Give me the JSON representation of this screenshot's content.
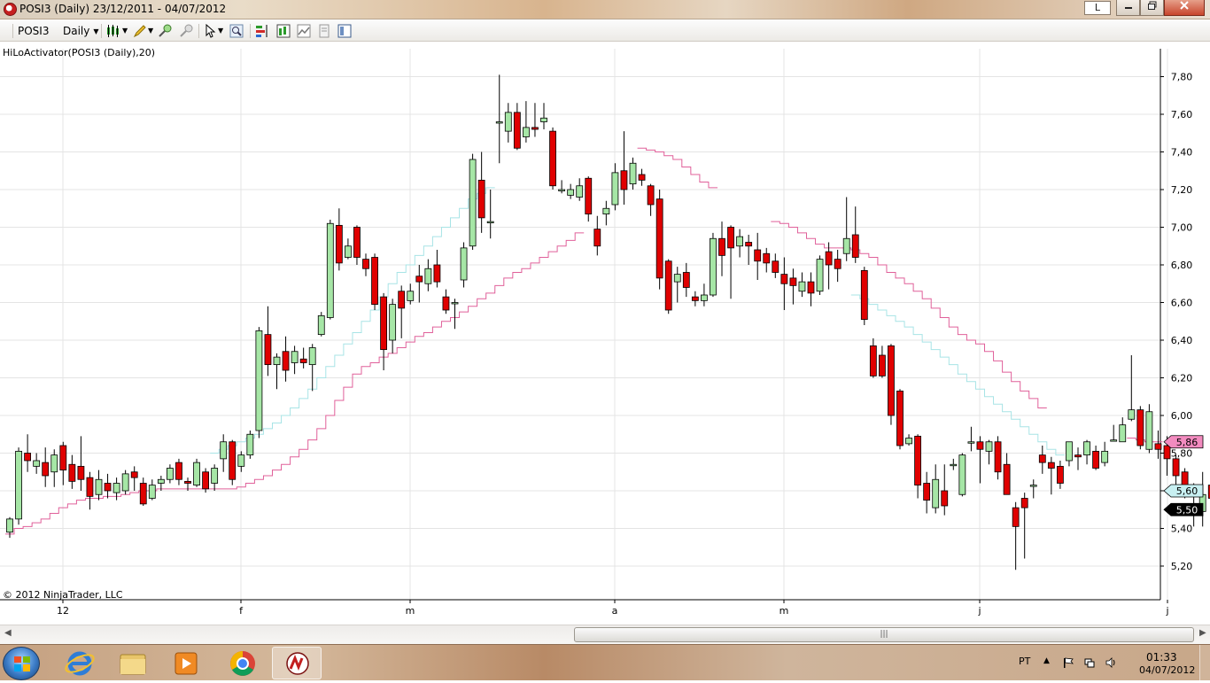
{
  "window": {
    "title": "POSI3 (Daily)  23/12/2011 - 04/07/2012",
    "btn_l": "L"
  },
  "toolbar": {
    "instrument": "POSI3",
    "interval": "Daily"
  },
  "chart": {
    "indicator_label": "HiLoActivator(POSI3 (Daily),20)",
    "copyright": "© 2012 NinjaTrader, LLC",
    "price_tag_upper": "5,86",
    "price_tag_mid": "5,60",
    "price_tag_last": "5,50"
  },
  "chart_data": {
    "type": "candlestick",
    "ylim": [
      5.1,
      7.9
    ],
    "y_ticks": [
      "7,80",
      "7,60",
      "7,40",
      "7,20",
      "7,00",
      "6,80",
      "6,60",
      "6,40",
      "6,20",
      "6,00",
      "5,80",
      "5,60",
      "5,40",
      "5,20"
    ],
    "x_tick_labels": [
      "12",
      "f",
      "m",
      "a",
      "m",
      "j",
      "j"
    ],
    "x_tick_index": [
      6,
      26,
      45,
      68,
      87,
      109,
      130
    ],
    "candles": [
      [
        5.38,
        5.45,
        5.35,
        5.46
      ],
      [
        5.45,
        5.81,
        5.42,
        5.83
      ],
      [
        5.8,
        5.76,
        5.7,
        5.9
      ],
      [
        5.73,
        5.76,
        5.69,
        5.8
      ],
      [
        5.75,
        5.68,
        5.62,
        5.83
      ],
      [
        5.7,
        5.79,
        5.62,
        5.82
      ],
      [
        5.84,
        5.71,
        5.63,
        5.86
      ],
      [
        5.74,
        5.65,
        5.61,
        5.79
      ],
      [
        5.73,
        5.66,
        5.6,
        5.89
      ],
      [
        5.67,
        5.57,
        5.5,
        5.7
      ],
      [
        5.58,
        5.66,
        5.55,
        5.71
      ],
      [
        5.64,
        5.6,
        5.56,
        5.69
      ],
      [
        5.59,
        5.64,
        5.55,
        5.67
      ],
      [
        5.6,
        5.69,
        5.58,
        5.71
      ],
      [
        5.7,
        5.67,
        5.6,
        5.73
      ],
      [
        5.64,
        5.53,
        5.52,
        5.67
      ],
      [
        5.56,
        5.63,
        5.55,
        5.66
      ],
      [
        5.64,
        5.66,
        5.6,
        5.68
      ],
      [
        5.66,
        5.72,
        5.64,
        5.74
      ],
      [
        5.75,
        5.66,
        5.63,
        5.77
      ],
      [
        5.65,
        5.64,
        5.6,
        5.67
      ],
      [
        5.63,
        5.75,
        5.62,
        5.77
      ],
      [
        5.7,
        5.61,
        5.59,
        5.72
      ],
      [
        5.64,
        5.72,
        5.6,
        5.74
      ],
      [
        5.77,
        5.86,
        5.7,
        5.9
      ],
      [
        5.86,
        5.66,
        5.63,
        5.87
      ],
      [
        5.73,
        5.79,
        5.7,
        5.81
      ],
      [
        5.79,
        5.9,
        5.77,
        5.92
      ],
      [
        5.92,
        6.45,
        5.88,
        6.47
      ],
      [
        6.43,
        6.27,
        6.21,
        6.58
      ],
      [
        6.27,
        6.31,
        6.14,
        6.33
      ],
      [
        6.34,
        6.24,
        6.18,
        6.42
      ],
      [
        6.28,
        6.34,
        6.22,
        6.37
      ],
      [
        6.3,
        6.28,
        6.25,
        6.36
      ],
      [
        6.27,
        6.36,
        6.13,
        6.38
      ],
      [
        6.43,
        6.53,
        6.42,
        6.55
      ],
      [
        6.52,
        7.02,
        6.51,
        7.04
      ],
      [
        7.01,
        6.81,
        6.77,
        7.1
      ],
      [
        6.84,
        6.9,
        6.83,
        6.94
      ],
      [
        7.0,
        6.84,
        6.8,
        7.01
      ],
      [
        6.83,
        6.78,
        6.74,
        6.86
      ],
      [
        6.84,
        6.59,
        6.56,
        6.86
      ],
      [
        6.63,
        6.35,
        6.24,
        6.65
      ],
      [
        6.4,
        6.59,
        6.33,
        6.62
      ],
      [
        6.66,
        6.57,
        6.41,
        6.69
      ],
      [
        6.61,
        6.66,
        6.59,
        6.7
      ],
      [
        6.74,
        6.71,
        6.6,
        6.8
      ],
      [
        6.7,
        6.78,
        6.66,
        6.83
      ],
      [
        6.8,
        6.71,
        6.68,
        6.88
      ],
      [
        6.63,
        6.56,
        6.54,
        6.67
      ],
      [
        6.6,
        6.6,
        6.46,
        6.62
      ],
      [
        6.72,
        6.89,
        6.68,
        6.92
      ],
      [
        6.9,
        7.36,
        6.88,
        7.39
      ],
      [
        7.25,
        7.05,
        6.97,
        7.4
      ],
      [
        7.03,
        7.03,
        6.94,
        7.2
      ],
      [
        7.56,
        7.56,
        7.34,
        7.81
      ],
      [
        7.51,
        7.61,
        7.45,
        7.66
      ],
      [
        7.61,
        7.42,
        7.41,
        7.66
      ],
      [
        7.48,
        7.53,
        7.45,
        7.67
      ],
      [
        7.53,
        7.52,
        7.48,
        7.66
      ],
      [
        7.56,
        7.58,
        7.52,
        7.66
      ],
      [
        7.51,
        7.22,
        7.2,
        7.53
      ],
      [
        7.2,
        7.2,
        7.18,
        7.25
      ],
      [
        7.17,
        7.2,
        7.15,
        7.23
      ],
      [
        7.16,
        7.22,
        7.14,
        7.26
      ],
      [
        7.26,
        7.07,
        7.03,
        7.27
      ],
      [
        6.99,
        6.9,
        6.85,
        7.06
      ],
      [
        7.07,
        7.1,
        7.01,
        7.14
      ],
      [
        7.12,
        7.29,
        7.09,
        7.34
      ],
      [
        7.3,
        7.2,
        7.12,
        7.51
      ],
      [
        7.23,
        7.34,
        7.2,
        7.37
      ],
      [
        7.28,
        7.25,
        7.22,
        7.31
      ],
      [
        7.22,
        7.12,
        7.06,
        7.23
      ],
      [
        7.15,
        6.73,
        6.67,
        7.2
      ],
      [
        6.82,
        6.56,
        6.54,
        6.83
      ],
      [
        6.71,
        6.75,
        6.6,
        6.79
      ],
      [
        6.76,
        6.68,
        6.63,
        6.81
      ],
      [
        6.63,
        6.61,
        6.58,
        6.66
      ],
      [
        6.61,
        6.64,
        6.58,
        6.7
      ],
      [
        6.64,
        6.94,
        6.63,
        6.97
      ],
      [
        6.94,
        6.85,
        6.74,
        7.03
      ],
      [
        7.0,
        6.89,
        6.62,
        7.01
      ],
      [
        6.9,
        6.95,
        6.84,
        6.99
      ],
      [
        6.92,
        6.9,
        6.8,
        6.96
      ],
      [
        6.88,
        6.82,
        6.72,
        6.97
      ],
      [
        6.86,
        6.81,
        6.76,
        6.89
      ],
      [
        6.82,
        6.76,
        6.73,
        6.86
      ],
      [
        6.75,
        6.7,
        6.56,
        6.84
      ],
      [
        6.73,
        6.69,
        6.59,
        6.78
      ],
      [
        6.66,
        6.71,
        6.63,
        6.76
      ],
      [
        6.71,
        6.65,
        6.58,
        6.76
      ],
      [
        6.66,
        6.83,
        6.64,
        6.85
      ],
      [
        6.87,
        6.8,
        6.67,
        6.92
      ],
      [
        6.83,
        6.78,
        6.71,
        6.88
      ],
      [
        6.86,
        6.94,
        6.82,
        7.16
      ],
      [
        6.96,
        6.84,
        6.81,
        7.11
      ],
      [
        6.77,
        6.51,
        6.48,
        6.79
      ],
      [
        6.37,
        6.21,
        6.2,
        6.41
      ],
      [
        6.32,
        6.21,
        6.2,
        6.37
      ],
      [
        6.37,
        6.0,
        5.95,
        6.38
      ],
      [
        6.13,
        5.84,
        5.82,
        6.14
      ],
      [
        5.85,
        5.88,
        5.84,
        5.9
      ],
      [
        5.89,
        5.63,
        5.56,
        5.9
      ],
      [
        5.64,
        5.55,
        5.48,
        5.7
      ],
      [
        5.51,
        5.66,
        5.48,
        5.74
      ],
      [
        5.6,
        5.52,
        5.47,
        5.74
      ],
      [
        5.74,
        5.74,
        5.71,
        5.77
      ],
      [
        5.58,
        5.79,
        5.57,
        5.8
      ],
      [
        5.86,
        5.86,
        5.81,
        5.94
      ],
      [
        5.86,
        5.82,
        5.64,
        5.89
      ],
      [
        5.81,
        5.86,
        5.74,
        5.87
      ],
      [
        5.86,
        5.7,
        5.66,
        5.89
      ],
      [
        5.74,
        5.58,
        5.58,
        5.8
      ],
      [
        5.51,
        5.41,
        5.18,
        5.54
      ],
      [
        5.56,
        5.51,
        5.24,
        5.59
      ],
      [
        5.63,
        5.63,
        5.56,
        5.66
      ],
      [
        5.79,
        5.75,
        5.69,
        5.84
      ],
      [
        5.75,
        5.72,
        5.58,
        5.78
      ],
      [
        5.73,
        5.64,
        5.61,
        5.76
      ],
      [
        5.76,
        5.86,
        5.73,
        5.85
      ],
      [
        5.79,
        5.78,
        5.71,
        5.83
      ],
      [
        5.79,
        5.86,
        5.74,
        5.87
      ],
      [
        5.81,
        5.72,
        5.71,
        5.84
      ],
      [
        5.75,
        5.81,
        5.73,
        5.86
      ],
      [
        5.87,
        5.87,
        5.87,
        5.95
      ],
      [
        5.86,
        5.95,
        5.86,
        5.99
      ],
      [
        5.98,
        6.03,
        5.97,
        6.32
      ],
      [
        6.03,
        5.84,
        5.82,
        6.05
      ],
      [
        5.82,
        6.02,
        5.8,
        6.06
      ],
      [
        5.85,
        5.82,
        5.77,
        5.92
      ],
      [
        5.84,
        5.77,
        5.68,
        5.89
      ],
      [
        5.77,
        5.68,
        5.63,
        5.79
      ],
      [
        5.7,
        5.63,
        5.56,
        5.72
      ],
      [
        5.57,
        5.63,
        5.41,
        5.64
      ],
      [
        5.49,
        5.58,
        5.41,
        5.7
      ],
      [
        5.63,
        5.56,
        5.49,
        5.72
      ],
      [
        5.52,
        5.56,
        5.48,
        5.64
      ],
      [
        5.62,
        5.66,
        5.42,
        5.63
      ],
      [
        5.53,
        5.53,
        5.48,
        5.58
      ]
    ],
    "support_line": [
      5.37,
      5.4,
      5.41,
      5.43,
      5.45,
      5.48,
      5.51,
      5.53,
      5.55,
      5.56,
      5.56,
      5.57,
      5.57,
      5.58,
      5.59,
      5.6,
      5.6,
      5.61,
      5.61,
      5.61,
      5.61,
      5.61,
      5.61,
      5.61,
      5.61,
      5.61,
      5.62,
      5.64,
      5.66,
      5.68,
      5.71,
      5.74,
      5.78,
      5.82,
      5.87,
      5.93,
      6.0,
      6.08,
      6.15,
      6.22,
      6.26,
      6.28,
      6.31,
      6.33,
      6.36,
      6.39,
      6.42,
      6.44,
      6.47,
      6.5,
      6.52,
      6.55,
      6.58,
      6.62,
      6.65,
      6.69,
      6.73,
      6.76,
      6.78,
      6.81,
      6.84,
      6.87,
      6.9,
      6.93,
      6.97
    ],
    "support_line_2": [
      5.8,
      5.82,
      5.84,
      5.86,
      5.88,
      5.9,
      5.93,
      5.96,
      6.0,
      6.04,
      6.09,
      6.14,
      6.2,
      6.26,
      6.32,
      6.38,
      6.44,
      6.5,
      6.56,
      6.63,
      6.7,
      6.76,
      6.8,
      6.85,
      6.9,
      6.95,
      7.0,
      7.05,
      7.1,
      7.15,
      7.18,
      7.21
    ],
    "resistance_line": [
      7.42,
      7.41,
      7.4,
      7.38,
      7.36,
      7.32,
      7.28,
      7.24,
      7.21
    ],
    "resistance_line_2": [
      7.03,
      7.02,
      7.0,
      6.97,
      6.94,
      6.91,
      6.89,
      6.89,
      6.89,
      6.88,
      6.86,
      6.84,
      6.8,
      6.76,
      6.73,
      6.7,
      6.66,
      6.62,
      6.57,
      6.52,
      6.47,
      6.43,
      6.4,
      6.38,
      6.34,
      6.29,
      6.23,
      6.18,
      6.13,
      6.09,
      6.04
    ],
    "lower_trail": [
      6.64,
      6.62,
      6.59,
      6.56,
      6.53,
      6.5,
      6.47,
      6.43,
      6.39,
      6.35,
      6.31,
      6.27,
      6.22,
      6.18,
      6.14,
      6.1,
      6.06,
      6.02,
      5.98,
      5.94,
      5.9,
      5.86,
      5.82,
      5.79
    ],
    "upper_trail_end": [
      5.88,
      5.87,
      5.86,
      5.86
    ]
  },
  "taskbar": {
    "language": "PT",
    "time": "01:33",
    "date": "04/07/2012"
  }
}
